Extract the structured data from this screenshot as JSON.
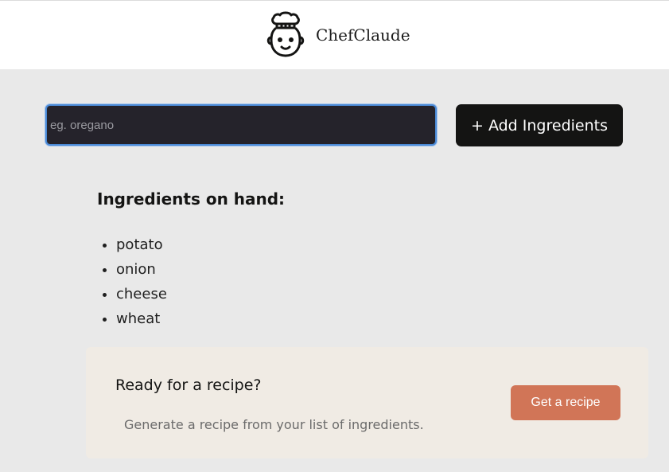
{
  "header": {
    "logo_icon": "chef-face-icon",
    "brand_name": "ChefClaude"
  },
  "form": {
    "input_value": "",
    "input_placeholder": "eg. oregano",
    "add_button_label": "+ Add Ingredients"
  },
  "ingredients": {
    "title": "Ingredients on hand:",
    "items": [
      "potato",
      "onion",
      "cheese",
      "wheat"
    ]
  },
  "recipe_panel": {
    "heading": "Ready for a recipe?",
    "description": "Generate a recipe from your list of ingredients.",
    "button_label": "Get a recipe"
  },
  "colors": {
    "page_background": "#e9e9e9",
    "header_background": "#ffffff",
    "input_background": "#25232b",
    "input_focus_border": "#4b8ad6",
    "add_button_background": "#141413",
    "panel_background": "#f0ebe4",
    "recipe_button_background": "#d17557"
  }
}
